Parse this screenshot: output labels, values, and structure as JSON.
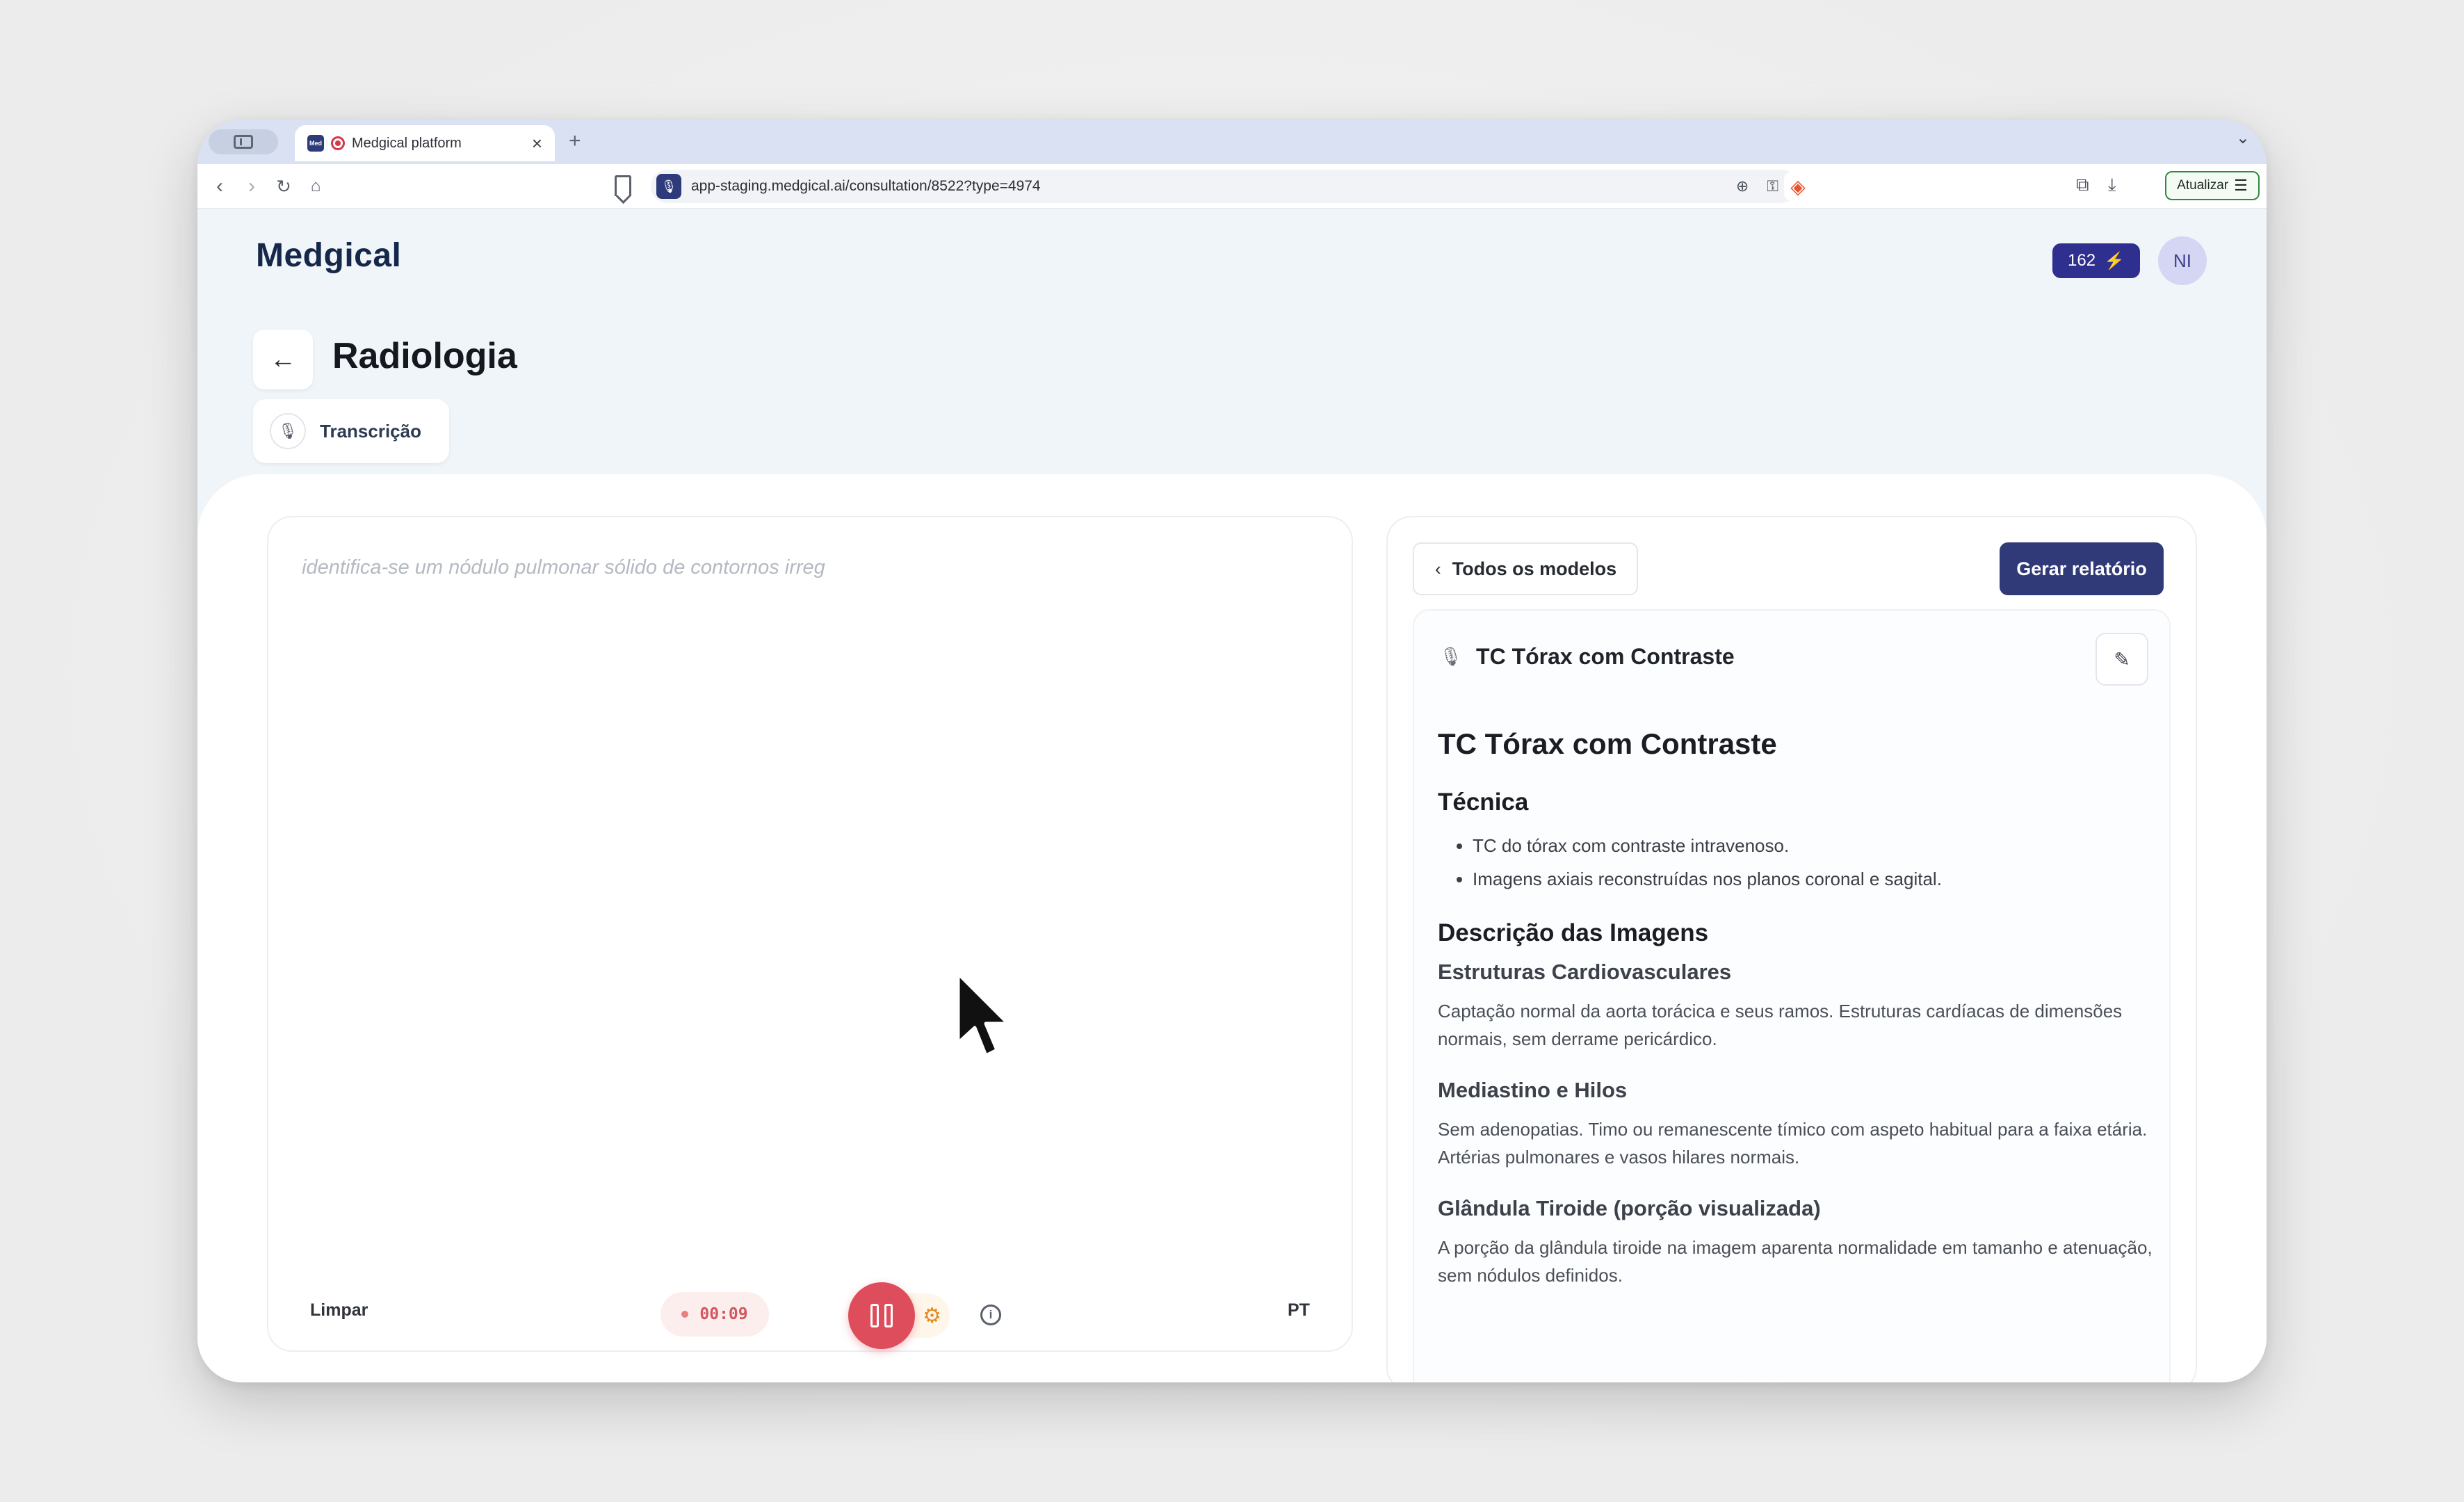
{
  "browser": {
    "tab_title": "Medgical platform",
    "tab_favicon_text": "Med",
    "url": "app-staging.medgical.ai/consultation/8522?type=4974",
    "update_label": "Atualizar"
  },
  "app": {
    "logo": "Medgical",
    "credits": "162",
    "avatar_initials": "NI",
    "page_title": "Radiologia",
    "transcription_tab": "Transcrição"
  },
  "editor": {
    "placeholder": "identifica-se um nódulo pulmonar sólido de contornos irreg",
    "clear_label": "Limpar",
    "timer": "00:09",
    "language": "PT"
  },
  "report": {
    "all_models_label": "Todos os modelos",
    "generate_label": "Gerar relatório",
    "template_name": "TC Tórax com Contraste",
    "title": "TC Tórax com Contraste",
    "technique_heading": "Técnica",
    "technique_items": [
      "TC do tórax com contraste intravenoso.",
      "Imagens axiais reconstruídas nos planos coronal e sagital."
    ],
    "images_heading": "Descrição das Imagens",
    "sections": [
      {
        "heading": "Estruturas Cardiovasculares",
        "text": "Captação normal da aorta torácica e seus ramos. Estruturas cardíacas de dimensões normais, sem derrame pericárdico."
      },
      {
        "heading": "Mediastino e Hilos",
        "text": "Sem adenopatias. Timo ou remanescente tímico com aspeto habitual para a faixa etária. Artérias pulmonares e vasos hilares normais."
      },
      {
        "heading": "Glândula Tiroide (porção visualizada)",
        "text": "A porção da glândula tiroide na imagem aparenta normalidade em tamanho e atenuação, sem nódulos definidos."
      }
    ]
  },
  "colors": {
    "primary": "#313a78",
    "credits_bg": "#2e2f8e",
    "record": "#de4d5b",
    "settings": "#e58a22"
  }
}
